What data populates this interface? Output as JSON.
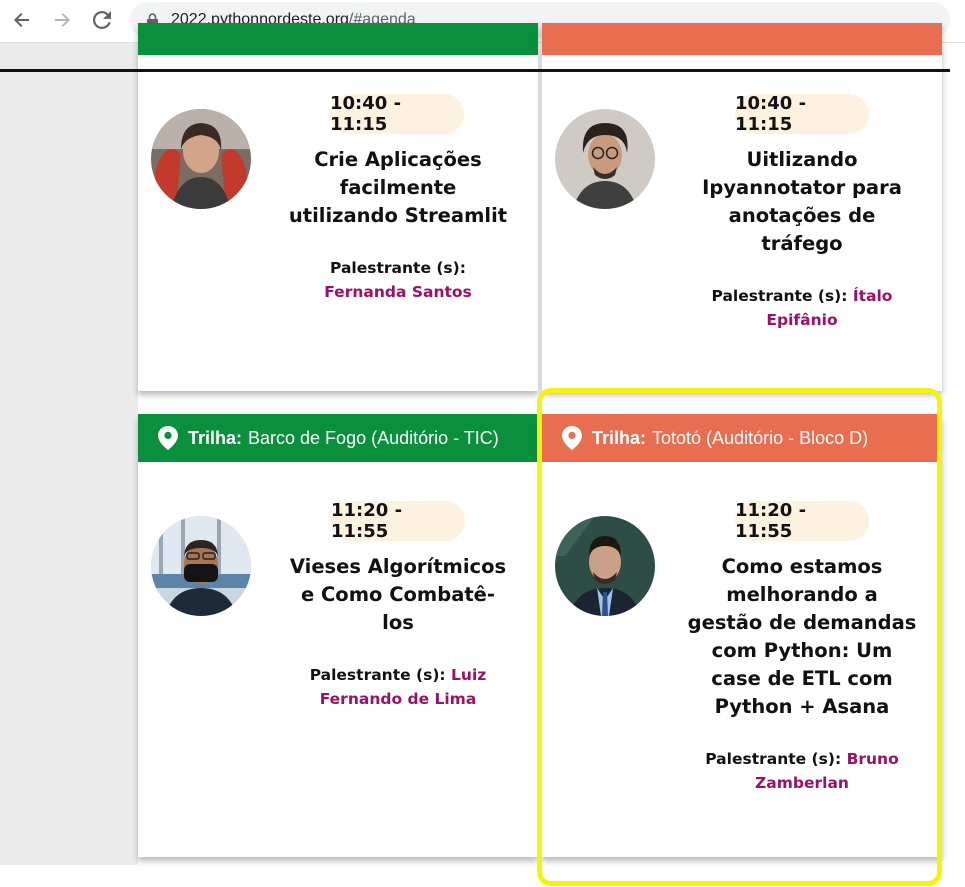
{
  "browser": {
    "url_host": "2022.pythonnordeste.org",
    "url_path": "/#agenda",
    "back_icon": "arrow-left-icon",
    "forward_icon": "arrow-right-icon",
    "reload_icon": "reload-icon",
    "lock_icon": "lock-icon"
  },
  "colors": {
    "green_track": "#0a8f3c",
    "orange_track": "#e96d51",
    "speaker_name": "#9b1167",
    "time_pill": "#fdf1e0",
    "highlight": "#f4f40a"
  },
  "sessions": [
    {
      "time": "10:40 - 11:15",
      "title_lines": [
        "Crie Aplicações",
        "facilmente",
        "utilizando Streamlit"
      ],
      "speaker_label": "Palestrante (s):",
      "speaker_line1": "",
      "speaker_line2": "Fernanda Santos"
    },
    {
      "time": "10:40 - 11:15",
      "title_lines": [
        "Uitlizando",
        "Ipyannotator para",
        "anotações de",
        "tráfego"
      ],
      "speaker_label": "Palestrante (s):",
      "speaker_line1": "Ítalo",
      "speaker_line2": "Epifânio"
    },
    {
      "track_label": "Trilha:",
      "track_name": "Barco de Fogo (Auditório - TIC)",
      "time": "11:20 - 11:55",
      "title_lines": [
        "Vieses Algorítmicos",
        "e Como Combatê-",
        "los"
      ],
      "speaker_label": "Palestrante (s):",
      "speaker_line1": "Luiz",
      "speaker_line2": "Fernando de Lima"
    },
    {
      "track_label": "Trilha:",
      "track_name": "Tototó (Auditório - Bloco D)",
      "time": "11:20 - 11:55",
      "title_lines": [
        "Como estamos",
        "melhorando a",
        "gestão de demandas",
        "com Python: Um",
        "case de ETL com",
        "Python + Asana"
      ],
      "speaker_label": "Palestrante (s):",
      "speaker_line1": "Bruno",
      "speaker_line2": "Zamberlan"
    }
  ]
}
